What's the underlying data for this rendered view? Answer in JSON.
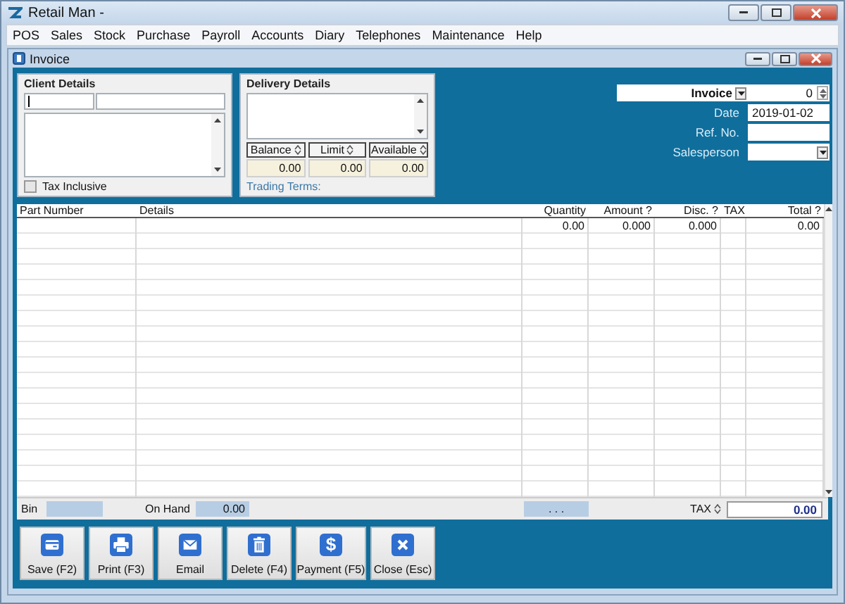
{
  "app": {
    "title": "Retail Man -"
  },
  "menu": [
    "POS",
    "Sales",
    "Stock",
    "Purchase",
    "Payroll",
    "Accounts",
    "Diary",
    "Telephones",
    "Maintenance",
    "Help"
  ],
  "document": {
    "title": "Invoice"
  },
  "client_details": {
    "title": "Client Details",
    "tax_inclusive": {
      "label": "Tax Inclusive",
      "checked": false
    }
  },
  "delivery_details": {
    "title": "Delivery Details",
    "trading_terms": "Trading Terms:",
    "balances": [
      {
        "label": "Balance",
        "value": "0.00"
      },
      {
        "label": "Limit",
        "value": "0.00"
      },
      {
        "label": "Available",
        "value": "0.00"
      }
    ]
  },
  "header": {
    "doc_type": "Invoice",
    "number": "0",
    "fields": [
      {
        "label": "Date",
        "kind": "text",
        "value": "2019-01-02"
      },
      {
        "label": "Ref. No.",
        "kind": "text"
      },
      {
        "label": "Salesperson",
        "kind": "dropdown"
      }
    ]
  },
  "grid": {
    "columns": [
      "Part Number",
      "Details",
      "Quantity",
      "Amount ?",
      "Disc. ?",
      "TAX",
      "Total ?"
    ],
    "rows": [
      [
        "",
        "",
        "0.00",
        "0.000",
        "0.000",
        "",
        "0.00"
      ]
    ]
  },
  "footer": {
    "bin_label": "Bin",
    "on_hand_label": "On Hand",
    "on_hand": "0.00",
    "middle": ". . .",
    "tax_label": "TAX",
    "total": "0.00"
  },
  "buttons": [
    {
      "label": "Save (F2)",
      "kind": "save"
    },
    {
      "label": "Print (F3)",
      "kind": "print"
    },
    {
      "label": "Email",
      "kind": "email"
    },
    {
      "label": "Delete (F4)",
      "kind": "delete"
    },
    {
      "label": "Payment (F5)",
      "kind": "payment",
      "glyph": "$"
    },
    {
      "label": "Close (Esc)",
      "kind": "close"
    }
  ]
}
